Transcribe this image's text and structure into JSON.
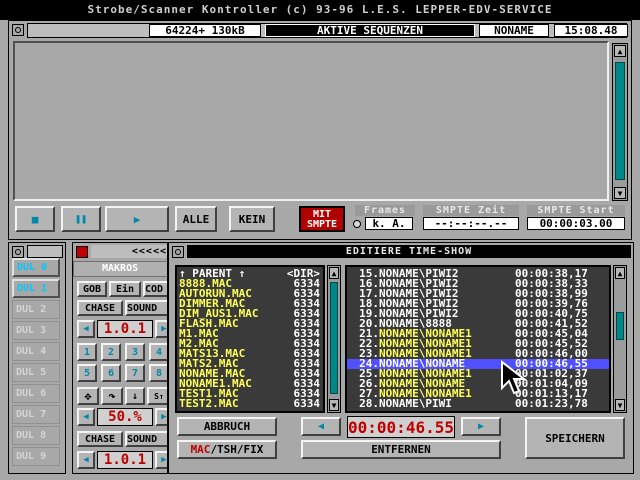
{
  "app": {
    "title": "Strobe/Scanner Kontroller (c) 93-96 L.E.S. LEPPER-EDV-SERVICE"
  },
  "top_window": {
    "memory": "64224+ 130kB",
    "title": "AKTIVE SEQUENZEN",
    "name": "NONAME",
    "time": "15:08.48",
    "buttons": {
      "stop": "■",
      "pause": "❚❚",
      "play": "▶",
      "alle": "ALLE",
      "kein": "KEIN"
    },
    "smpte_button": [
      "MIT",
      "SMPTE"
    ],
    "frames_label": "Frames",
    "frames_value": "k. A.",
    "smpte_zeit_label": "SMPTE Zeit",
    "smpte_zeit_value": "--:--:--.--",
    "smpte_start_label": "SMPTE Start",
    "smpte_start_value": "00:00:03.00"
  },
  "dul_panel": {
    "items": [
      "DUL 0",
      "DUL 1",
      "DUL 2",
      "DUL 3",
      "DUL 4",
      "DUL 5",
      "DUL 6",
      "DUL 7",
      "DUL 8",
      "DUL 9"
    ],
    "active": [
      0,
      1
    ]
  },
  "makros_panel": {
    "arrows": "<<<<<",
    "label": "MAKROS",
    "gob": "GOB",
    "ein": "Ein",
    "cod": "COD",
    "chase": "CHASE",
    "sound": "SOUND",
    "counter1": "1.0.1",
    "numbers": [
      "1",
      "2",
      "3",
      "4",
      "5",
      "6",
      "7",
      "8"
    ],
    "percent": "50.%",
    "chase2": "CHASE",
    "sound2": "SOUND",
    "counter2": "1.0.1"
  },
  "editor": {
    "title": "EDITIERE TIME-SHOW",
    "files": [
      {
        "name": "↑ PARENT ↑",
        "size": "<DIR>"
      },
      {
        "name": "8888.MAC",
        "size": "6334"
      },
      {
        "name": "AUTORUN.MAC",
        "size": "6334"
      },
      {
        "name": "DIMMER.MAC",
        "size": "6334"
      },
      {
        "name": "DIM_AUS1.MAC",
        "size": "6334"
      },
      {
        "name": "FLASH.MAC",
        "size": "6334"
      },
      {
        "name": "M1.MAC",
        "size": "6334"
      },
      {
        "name": "M2.MAC",
        "size": "6334"
      },
      {
        "name": "MATS13.MAC",
        "size": "6334"
      },
      {
        "name": "MATS2.MAC",
        "size": "6334"
      },
      {
        "name": "NONAME.MAC",
        "size": "6334"
      },
      {
        "name": "NONAME1.MAC",
        "size": "6334"
      },
      {
        "name": "TEST1.MAC",
        "size": "6334"
      },
      {
        "name": "TEST2.MAC",
        "size": "6334"
      }
    ],
    "show": [
      {
        "idx": "15.",
        "name": "NONAME\\PIWI2",
        "time": "00:00:38,17",
        "color": "white"
      },
      {
        "idx": "16.",
        "name": "NONAME\\PIWI2",
        "time": "00:00:38,33",
        "color": "white"
      },
      {
        "idx": "17.",
        "name": "NONAME\\PIWI2",
        "time": "00:00:38,99",
        "color": "white"
      },
      {
        "idx": "18.",
        "name": "NONAME\\PIWI2",
        "time": "00:00:39,76",
        "color": "white"
      },
      {
        "idx": "19.",
        "name": "NONAME\\PIWI2",
        "time": "00:00:40,75",
        "color": "white"
      },
      {
        "idx": "20.",
        "name": "NONAME\\8888",
        "time": "00:00:41,52",
        "color": "white"
      },
      {
        "idx": "21.",
        "name": "NONAME\\NONAME1",
        "time": "00:00:45,04",
        "color": "yellow"
      },
      {
        "idx": "22.",
        "name": "NONAME\\NONAME1",
        "time": "00:00:45,52",
        "color": "yellow"
      },
      {
        "idx": "23.",
        "name": "NONAME\\NONAME1",
        "time": "00:00:46,00",
        "color": "yellow"
      },
      {
        "idx": "24.",
        "name": "NONAME\\NONAME",
        "time": "00:00:46,55",
        "color": "selected"
      },
      {
        "idx": "25.",
        "name": "NONAME\\NONAME1",
        "time": "00:01:02,37",
        "color": "yellow"
      },
      {
        "idx": "26.",
        "name": "NONAME\\NONAME",
        "time": "00:01:04,09",
        "color": "yellow"
      },
      {
        "idx": "27.",
        "name": "NONAME\\NONAME1",
        "time": "00:01:13,17",
        "color": "yellow"
      },
      {
        "idx": "28.",
        "name": "NONAME\\PIWI",
        "time": "00:01:23,78",
        "color": "white"
      }
    ],
    "abbruch": "ABBRUCH",
    "mode_red": "MAC",
    "mode_rest": "/TSH/FIX",
    "timecode": "00:00:46.55",
    "entfernen": "ENTFERNEN",
    "speichern": "SPEICHERN"
  },
  "colors": {
    "accent_red": "#c00000",
    "selection": "#5050ff",
    "scroll": "#008888",
    "file_yellow": "#ffff55"
  }
}
